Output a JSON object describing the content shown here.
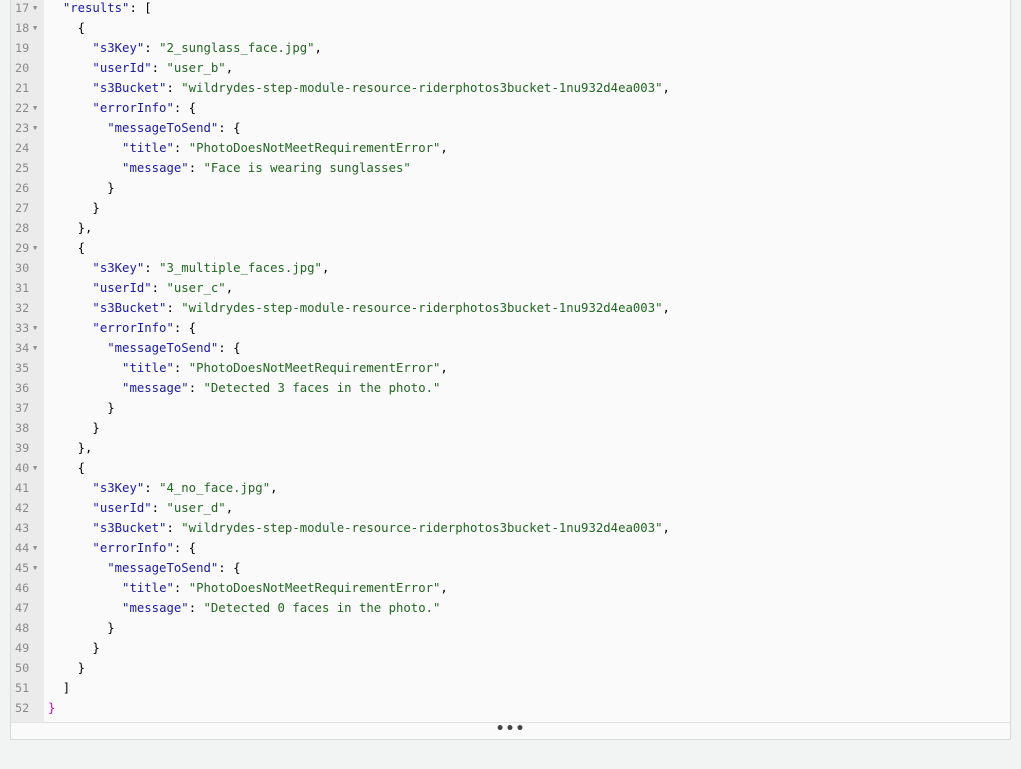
{
  "lines": [
    {
      "n": "17",
      "fold": true,
      "tokens": [
        [
          "p",
          "  "
        ],
        [
          "k",
          "\"results\""
        ],
        [
          "p",
          ": ["
        ]
      ]
    },
    {
      "n": "18",
      "fold": true,
      "tokens": [
        [
          "p",
          "    {"
        ]
      ]
    },
    {
      "n": "19",
      "fold": false,
      "tokens": [
        [
          "p",
          "      "
        ],
        [
          "k",
          "\"s3Key\""
        ],
        [
          "p",
          ": "
        ],
        [
          "s",
          "\"2_sunglass_face.jpg\""
        ],
        [
          "p",
          ","
        ]
      ]
    },
    {
      "n": "20",
      "fold": false,
      "tokens": [
        [
          "p",
          "      "
        ],
        [
          "k",
          "\"userId\""
        ],
        [
          "p",
          ": "
        ],
        [
          "s",
          "\"user_b\""
        ],
        [
          "p",
          ","
        ]
      ]
    },
    {
      "n": "21",
      "fold": false,
      "tokens": [
        [
          "p",
          "      "
        ],
        [
          "k",
          "\"s3Bucket\""
        ],
        [
          "p",
          ": "
        ],
        [
          "s",
          "\"wildrydes-step-module-resource-riderphotos3bucket-1nu932d4ea003\""
        ],
        [
          "p",
          ","
        ]
      ]
    },
    {
      "n": "22",
      "fold": true,
      "tokens": [
        [
          "p",
          "      "
        ],
        [
          "k",
          "\"errorInfo\""
        ],
        [
          "p",
          ": {"
        ]
      ]
    },
    {
      "n": "23",
      "fold": true,
      "tokens": [
        [
          "p",
          "        "
        ],
        [
          "k",
          "\"messageToSend\""
        ],
        [
          "p",
          ": {"
        ]
      ]
    },
    {
      "n": "24",
      "fold": false,
      "tokens": [
        [
          "p",
          "          "
        ],
        [
          "k",
          "\"title\""
        ],
        [
          "p",
          ": "
        ],
        [
          "s",
          "\"PhotoDoesNotMeetRequirementError\""
        ],
        [
          "p",
          ","
        ]
      ]
    },
    {
      "n": "25",
      "fold": false,
      "tokens": [
        [
          "p",
          "          "
        ],
        [
          "k",
          "\"message\""
        ],
        [
          "p",
          ": "
        ],
        [
          "s",
          "\"Face is wearing sunglasses\""
        ]
      ]
    },
    {
      "n": "26",
      "fold": false,
      "tokens": [
        [
          "p",
          "        }"
        ]
      ]
    },
    {
      "n": "27",
      "fold": false,
      "tokens": [
        [
          "p",
          "      }"
        ]
      ]
    },
    {
      "n": "28",
      "fold": false,
      "tokens": [
        [
          "p",
          "    },"
        ]
      ]
    },
    {
      "n": "29",
      "fold": true,
      "tokens": [
        [
          "p",
          "    {"
        ]
      ]
    },
    {
      "n": "30",
      "fold": false,
      "tokens": [
        [
          "p",
          "      "
        ],
        [
          "k",
          "\"s3Key\""
        ],
        [
          "p",
          ": "
        ],
        [
          "s",
          "\"3_multiple_faces.jpg\""
        ],
        [
          "p",
          ","
        ]
      ]
    },
    {
      "n": "31",
      "fold": false,
      "tokens": [
        [
          "p",
          "      "
        ],
        [
          "k",
          "\"userId\""
        ],
        [
          "p",
          ": "
        ],
        [
          "s",
          "\"user_c\""
        ],
        [
          "p",
          ","
        ]
      ]
    },
    {
      "n": "32",
      "fold": false,
      "tokens": [
        [
          "p",
          "      "
        ],
        [
          "k",
          "\"s3Bucket\""
        ],
        [
          "p",
          ": "
        ],
        [
          "s",
          "\"wildrydes-step-module-resource-riderphotos3bucket-1nu932d4ea003\""
        ],
        [
          "p",
          ","
        ]
      ]
    },
    {
      "n": "33",
      "fold": true,
      "tokens": [
        [
          "p",
          "      "
        ],
        [
          "k",
          "\"errorInfo\""
        ],
        [
          "p",
          ": {"
        ]
      ]
    },
    {
      "n": "34",
      "fold": true,
      "tokens": [
        [
          "p",
          "        "
        ],
        [
          "k",
          "\"messageToSend\""
        ],
        [
          "p",
          ": {"
        ]
      ]
    },
    {
      "n": "35",
      "fold": false,
      "tokens": [
        [
          "p",
          "          "
        ],
        [
          "k",
          "\"title\""
        ],
        [
          "p",
          ": "
        ],
        [
          "s",
          "\"PhotoDoesNotMeetRequirementError\""
        ],
        [
          "p",
          ","
        ]
      ]
    },
    {
      "n": "36",
      "fold": false,
      "tokens": [
        [
          "p",
          "          "
        ],
        [
          "k",
          "\"message\""
        ],
        [
          "p",
          ": "
        ],
        [
          "s",
          "\"Detected 3 faces in the photo.\""
        ]
      ]
    },
    {
      "n": "37",
      "fold": false,
      "tokens": [
        [
          "p",
          "        }"
        ]
      ]
    },
    {
      "n": "38",
      "fold": false,
      "tokens": [
        [
          "p",
          "      }"
        ]
      ]
    },
    {
      "n": "39",
      "fold": false,
      "tokens": [
        [
          "p",
          "    },"
        ]
      ]
    },
    {
      "n": "40",
      "fold": true,
      "tokens": [
        [
          "p",
          "    {"
        ]
      ]
    },
    {
      "n": "41",
      "fold": false,
      "tokens": [
        [
          "p",
          "      "
        ],
        [
          "k",
          "\"s3Key\""
        ],
        [
          "p",
          ": "
        ],
        [
          "s",
          "\"4_no_face.jpg\""
        ],
        [
          "p",
          ","
        ]
      ]
    },
    {
      "n": "42",
      "fold": false,
      "tokens": [
        [
          "p",
          "      "
        ],
        [
          "k",
          "\"userId\""
        ],
        [
          "p",
          ": "
        ],
        [
          "s",
          "\"user_d\""
        ],
        [
          "p",
          ","
        ]
      ]
    },
    {
      "n": "43",
      "fold": false,
      "tokens": [
        [
          "p",
          "      "
        ],
        [
          "k",
          "\"s3Bucket\""
        ],
        [
          "p",
          ": "
        ],
        [
          "s",
          "\"wildrydes-step-module-resource-riderphotos3bucket-1nu932d4ea003\""
        ],
        [
          "p",
          ","
        ]
      ]
    },
    {
      "n": "44",
      "fold": true,
      "tokens": [
        [
          "p",
          "      "
        ],
        [
          "k",
          "\"errorInfo\""
        ],
        [
          "p",
          ": {"
        ]
      ]
    },
    {
      "n": "45",
      "fold": true,
      "tokens": [
        [
          "p",
          "        "
        ],
        [
          "k",
          "\"messageToSend\""
        ],
        [
          "p",
          ": {"
        ]
      ]
    },
    {
      "n": "46",
      "fold": false,
      "tokens": [
        [
          "p",
          "          "
        ],
        [
          "k",
          "\"title\""
        ],
        [
          "p",
          ": "
        ],
        [
          "s",
          "\"PhotoDoesNotMeetRequirementError\""
        ],
        [
          "p",
          ","
        ]
      ]
    },
    {
      "n": "47",
      "fold": false,
      "tokens": [
        [
          "p",
          "          "
        ],
        [
          "k",
          "\"message\""
        ],
        [
          "p",
          ": "
        ],
        [
          "s",
          "\"Detected 0 faces in the photo.\""
        ]
      ]
    },
    {
      "n": "48",
      "fold": false,
      "tokens": [
        [
          "p",
          "        }"
        ]
      ]
    },
    {
      "n": "49",
      "fold": false,
      "tokens": [
        [
          "p",
          "      }"
        ]
      ]
    },
    {
      "n": "50",
      "fold": false,
      "tokens": [
        [
          "p",
          "    }"
        ]
      ]
    },
    {
      "n": "51",
      "fold": false,
      "tokens": [
        [
          "p",
          "  ]"
        ]
      ]
    },
    {
      "n": "52",
      "fold": false,
      "tokens": [
        [
          "e",
          "}"
        ]
      ]
    }
  ],
  "fold_glyph": "▼",
  "resize_handle_label": "•••",
  "colors": {
    "key": "#1a1aa6",
    "string": "#226622",
    "closing_brace": "#d000d0",
    "gutter": "#ebebeb"
  }
}
